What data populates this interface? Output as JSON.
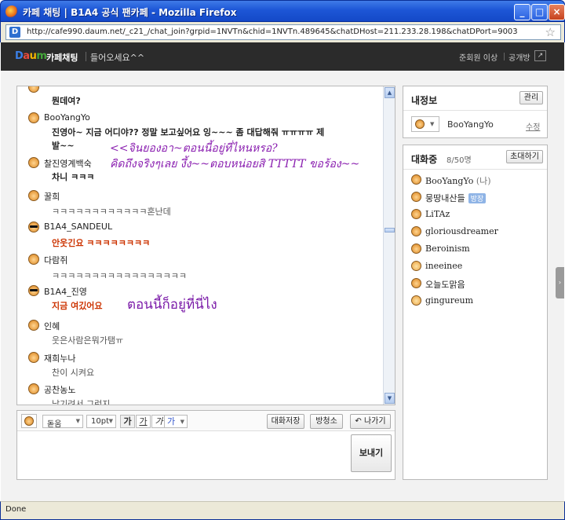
{
  "window": {
    "title": "카페 채팅 | B1A4 공식 팬카페 - Mozilla Firefox",
    "url": "http://cafe990.daum.net/_c21_/chat_join?grpid=1NVTn&chid=1NVTn.489645&chatDHost=211.233.28.198&chatDPort=9003"
  },
  "header": {
    "logo": "Daum",
    "service": "카페채팅",
    "room_title": "들어오세요^^",
    "level": "준회원 이상",
    "visibility": "공개방",
    "popout_icon": "popout-icon"
  },
  "chat": {
    "messages": [
      {
        "name": "",
        "text": "뭔데여?",
        "style": "bold",
        "avatar": "smiley"
      },
      {
        "name": "BooYangYo",
        "text": "진영아~ 지금 어디야?? 정말 보고싶어요 잉~~~ 좀 대답해줘 ㅠㅠㅠㅠ 제",
        "text2": "발~~",
        "style": "bold",
        "avatar": "smiley"
      },
      {
        "name": "찰진영계백숙",
        "text": "차니 ㅋㅋㅋ",
        "style": "bold",
        "avatar": "smiley"
      },
      {
        "name": "꿀희",
        "text": "ㅋㅋㅋㅋㅋㅋㅋㅋㅋㅋㅋㅋ혼난데",
        "style": "gray",
        "avatar": "smiley"
      },
      {
        "name": "B1A4_SANDEUL",
        "text": "안웃긴요 ㅋㅋㅋㅋㅋㅋㅋㅋ",
        "style": "red",
        "avatar": "shades"
      },
      {
        "name": "다람쥐",
        "text": "ㅋㅋㅋㅋㅋㅋㅋㅋㅋㅋㅋㅋㅋㅋㅋㅋㅋ",
        "style": "gray",
        "avatar": "smiley"
      },
      {
        "name": "B1A4_진영",
        "text": "지금 여깄어요",
        "style": "red",
        "avatar": "shades"
      },
      {
        "name": "인혜",
        "text": "웃은사람은뭐가탬ㅠ",
        "style": "gray",
        "avatar": "smiley"
      },
      {
        "name": "재희누나",
        "text": "찬이 시켜요",
        "style": "gray",
        "avatar": "smiley"
      },
      {
        "name": "공찬농노",
        "text": "남기려서 그런지",
        "style": "gray",
        "avatar": "smiley"
      }
    ],
    "overlays": [
      "<<จินยองอา~ตอนนี้อยู่ที่ไหนหรอ?",
      "คิดถึงจริงๆเลย งึ้ง~~ตอบหน่อยสิ TTTTT ขอร้อง~~",
      "ตอนนี้ก็อยู่ที่นี่ไง"
    ],
    "scroll_up": "▲",
    "scroll_down": "▼"
  },
  "composer": {
    "font_face": "돋움",
    "font_size": "10pt",
    "bold": "가",
    "italic": "가",
    "underline": "가",
    "color": "가",
    "save_label": "대화저장",
    "clear_label": "방청소",
    "exit_label": "나가기",
    "send_label": "보내기",
    "text": ""
  },
  "profile": {
    "title": "내정보",
    "manage_label": "관리",
    "nickname": "BooYangYo",
    "edit_label": "수정"
  },
  "participants": {
    "title": "대화중",
    "count": "8/50명",
    "invite_label": "초대하기",
    "me_suffix": "(나)",
    "host_badge": "방장",
    "users": [
      {
        "name": "BooYangYo",
        "me": true,
        "host": false
      },
      {
        "name": "뭉땅내산들",
        "me": false,
        "host": true
      },
      {
        "name": "LiTAz",
        "me": false,
        "host": false
      },
      {
        "name": "gloriousdreamer",
        "me": false,
        "host": false
      },
      {
        "name": "Beroinism",
        "me": false,
        "host": false
      },
      {
        "name": "ineeinee",
        "me": false,
        "host": false
      },
      {
        "name": "오늘도맑음",
        "me": false,
        "host": false
      },
      {
        "name": "gingureum",
        "me": false,
        "host": false
      }
    ]
  },
  "status": {
    "text": "Done"
  }
}
